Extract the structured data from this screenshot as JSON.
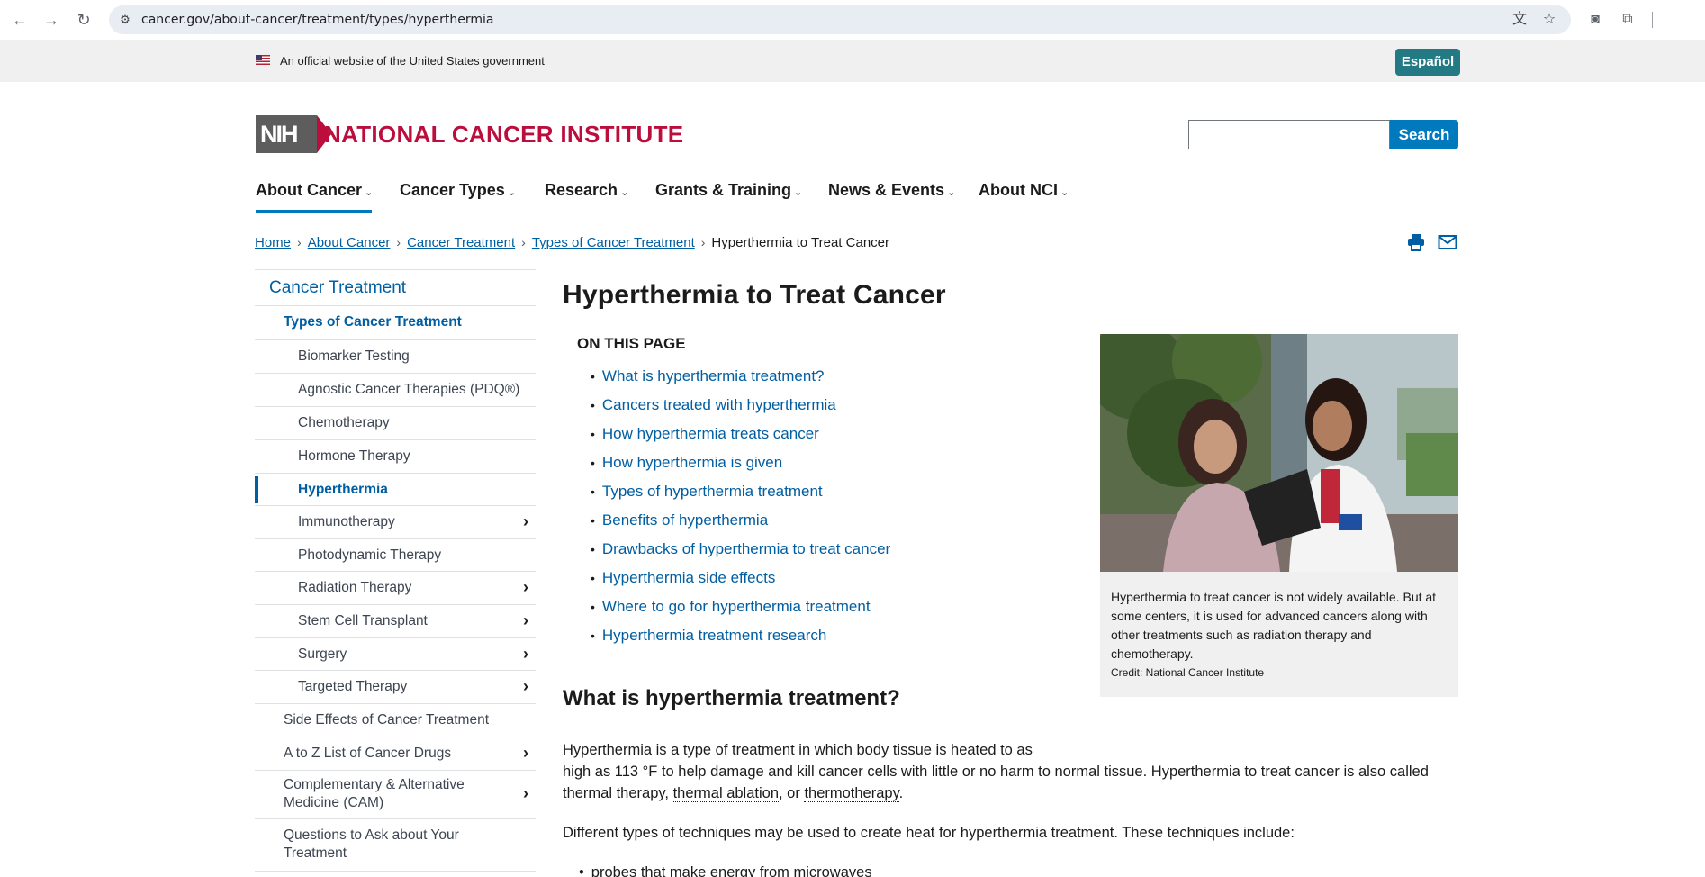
{
  "browser": {
    "url": "cancer.gov/about-cancer/treatment/types/hyperthermia"
  },
  "gov_banner": {
    "text": "An official website of the United States government",
    "language_button": "Español"
  },
  "header": {
    "logo_nih": "NIH",
    "site_title": "NATIONAL CANCER INSTITUTE",
    "search_value": "",
    "search_button": "Search"
  },
  "main_nav": [
    {
      "label": "About Cancer"
    },
    {
      "label": "Cancer Types"
    },
    {
      "label": "Research"
    },
    {
      "label": "Grants & Training"
    },
    {
      "label": "News & Events"
    },
    {
      "label": "About NCI"
    }
  ],
  "breadcrumb": {
    "items": [
      "Home",
      "About Cancer",
      "Cancer Treatment",
      "Types of Cancer Treatment"
    ],
    "current": "Hyperthermia to Treat Cancer"
  },
  "sidebar": {
    "title": "Cancer Treatment",
    "section": "Types of Cancer Treatment",
    "subitems": [
      {
        "label": "Biomarker Testing"
      },
      {
        "label": "Agnostic Cancer Therapies (PDQ®)"
      },
      {
        "label": "Chemotherapy"
      },
      {
        "label": "Hormone Therapy"
      },
      {
        "label": "Hyperthermia"
      },
      {
        "label": "Immunotherapy"
      },
      {
        "label": "Photodynamic Therapy"
      },
      {
        "label": "Radiation Therapy"
      },
      {
        "label": "Stem Cell Transplant"
      },
      {
        "label": "Surgery"
      },
      {
        "label": "Targeted Therapy"
      }
    ],
    "items": [
      {
        "label": "Side Effects of Cancer Treatment"
      },
      {
        "label": "A to Z List of Cancer Drugs"
      },
      {
        "label": "Complementary & Alternative Medicine (CAM)"
      },
      {
        "label": "Questions to Ask about Your Treatment"
      }
    ]
  },
  "content": {
    "title": "Hyperthermia to Treat Cancer",
    "on_this_page_title": "ON THIS PAGE",
    "on_this_page": [
      "What is hyperthermia treatment?",
      "Cancers treated with hyperthermia",
      "How hyperthermia treats cancer",
      "How hyperthermia is given",
      "Types of hyperthermia treatment",
      "Benefits of hyperthermia",
      "Drawbacks of hyperthermia to treat cancer",
      "Hyperthermia side effects",
      "Where to go for hyperthermia treatment",
      "Hyperthermia treatment research"
    ],
    "figure_caption": "Hyperthermia to treat cancer is not widely available. But at some centers, it is used for advanced cancers along with other treatments such as radiation therapy and chemotherapy.",
    "figure_credit": "Credit: National Cancer Institute",
    "section_heading": "What is hyperthermia treatment?",
    "para1_line1": "Hyperthermia is a type of treatment in which body tissue is heated to as",
    "para1_line2": "high as 113 °F to help damage and kill cancer cells with little or no harm to normal tissue. Hyperthermia to treat cancer is also called",
    "para1_line3_start": "thermal therapy, ",
    "term_1": "thermal ablation",
    "para1_line3_mid": ", or ",
    "term_2": "thermotherapy",
    "para1_line3_end": ".",
    "para2": "Different types of techniques may be used to create heat for hyperthermia treatment. These techniques include:",
    "bullet_partial": "probes that make energy from microwaves"
  }
}
